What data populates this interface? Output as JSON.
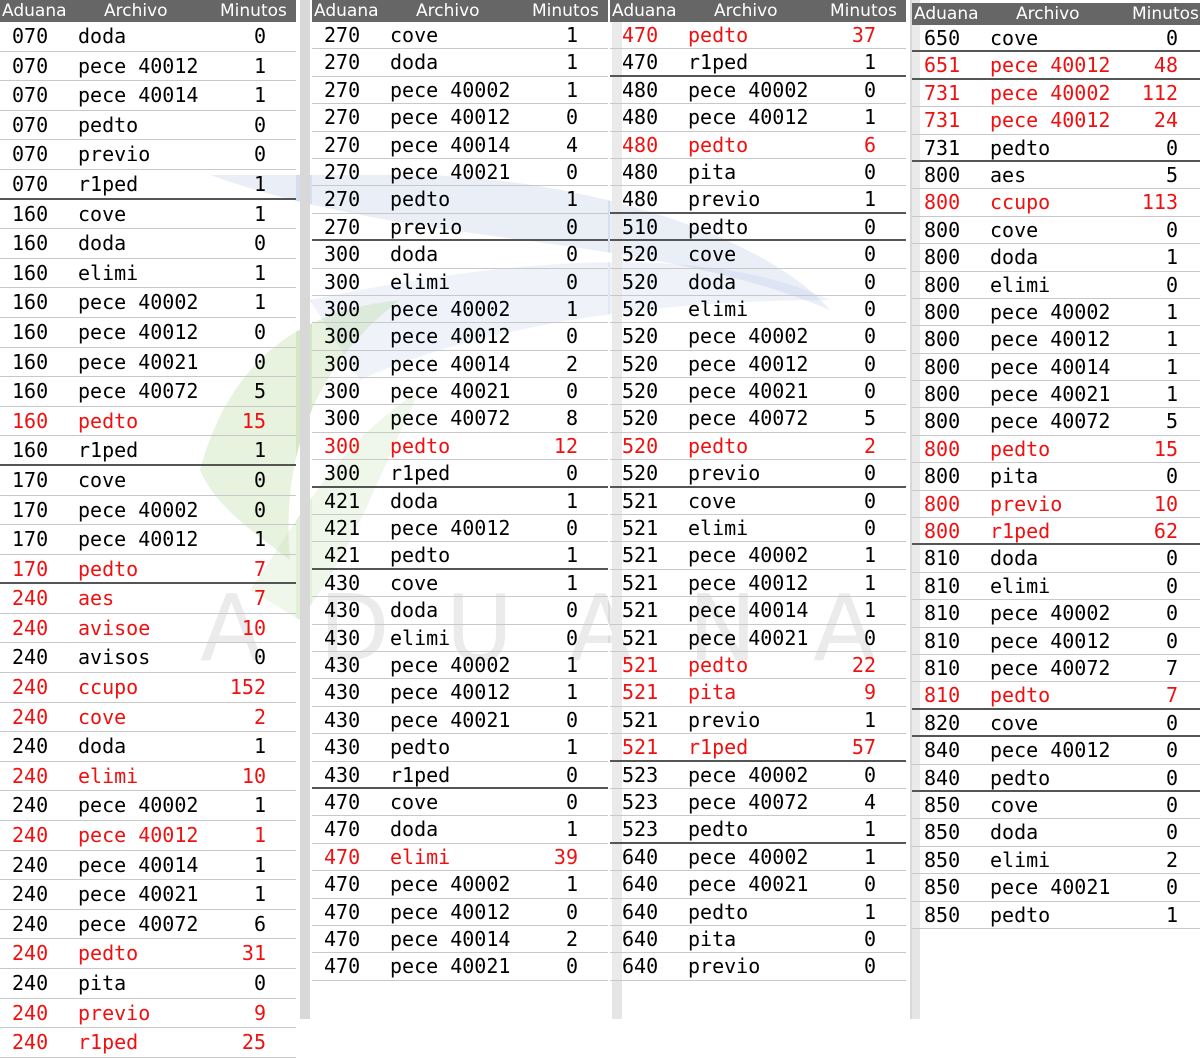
{
  "headers": {
    "aduana": "Aduana",
    "archivo": "Archivo",
    "minutos": "Minutos"
  },
  "watermark": {
    "text": "ADUANA",
    "colors": {
      "blue": "#5b7fc6",
      "green": "#7dbb4f",
      "gray": "#9a9a9a"
    }
  },
  "colors": {
    "header_bg": "#666666",
    "header_text": "#ffffff",
    "highlight_text": "#ee1111",
    "normal_text": "#000000"
  },
  "columns": [
    {
      "rows": [
        {
          "aduana": "070",
          "archivo": "doda",
          "minutos": "0"
        },
        {
          "aduana": "070",
          "archivo": "pece 40012",
          "minutos": "1"
        },
        {
          "aduana": "070",
          "archivo": "pece 40014",
          "minutos": "1"
        },
        {
          "aduana": "070",
          "archivo": "pedto",
          "minutos": "0"
        },
        {
          "aduana": "070",
          "archivo": "previo",
          "minutos": "0"
        },
        {
          "aduana": "070",
          "archivo": "r1ped",
          "minutos": "1"
        },
        {
          "aduana": "160",
          "archivo": "cove",
          "minutos": "1"
        },
        {
          "aduana": "160",
          "archivo": "doda",
          "minutos": "0"
        },
        {
          "aduana": "160",
          "archivo": "elimi",
          "minutos": "1"
        },
        {
          "aduana": "160",
          "archivo": "pece 40002",
          "minutos": "1"
        },
        {
          "aduana": "160",
          "archivo": "pece 40012",
          "minutos": "0"
        },
        {
          "aduana": "160",
          "archivo": "pece 40021",
          "minutos": "0"
        },
        {
          "aduana": "160",
          "archivo": "pece 40072",
          "minutos": "5"
        },
        {
          "aduana": "160",
          "archivo": "pedto",
          "minutos": "15",
          "red": true
        },
        {
          "aduana": "160",
          "archivo": "r1ped",
          "minutos": "1"
        },
        {
          "aduana": "170",
          "archivo": "cove",
          "minutos": "0"
        },
        {
          "aduana": "170",
          "archivo": "pece 40002",
          "minutos": "0"
        },
        {
          "aduana": "170",
          "archivo": "pece 40012",
          "minutos": "1"
        },
        {
          "aduana": "170",
          "archivo": "pedto",
          "minutos": "7",
          "red": true
        },
        {
          "aduana": "240",
          "archivo": "aes",
          "minutos": "7",
          "red": true
        },
        {
          "aduana": "240",
          "archivo": "avisoe",
          "minutos": "10",
          "red": true
        },
        {
          "aduana": "240",
          "archivo": "avisos",
          "minutos": "0"
        },
        {
          "aduana": "240",
          "archivo": "ccupo",
          "minutos": "152",
          "red": true
        },
        {
          "aduana": "240",
          "archivo": "cove",
          "minutos": "2",
          "red": true
        },
        {
          "aduana": "240",
          "archivo": "doda",
          "minutos": "1"
        },
        {
          "aduana": "240",
          "archivo": "elimi",
          "minutos": "10",
          "red": true
        },
        {
          "aduana": "240",
          "archivo": "pece 40002",
          "minutos": "1"
        },
        {
          "aduana": "240",
          "archivo": "pece 40012",
          "minutos": "1",
          "red": true
        },
        {
          "aduana": "240",
          "archivo": "pece 40014",
          "minutos": "1"
        },
        {
          "aduana": "240",
          "archivo": "pece 40021",
          "minutos": "1"
        },
        {
          "aduana": "240",
          "archivo": "pece 40072",
          "minutos": "6"
        },
        {
          "aduana": "240",
          "archivo": "pedto",
          "minutos": "31",
          "red": true
        },
        {
          "aduana": "240",
          "archivo": "pita",
          "minutos": "0"
        },
        {
          "aduana": "240",
          "archivo": "previo",
          "minutos": "9",
          "red": true
        },
        {
          "aduana": "240",
          "archivo": "r1ped",
          "minutos": "25",
          "red": true
        }
      ]
    },
    {
      "rows": [
        {
          "aduana": "270",
          "archivo": "cove",
          "minutos": "1"
        },
        {
          "aduana": "270",
          "archivo": "doda",
          "minutos": "1"
        },
        {
          "aduana": "270",
          "archivo": "pece 40002",
          "minutos": "1"
        },
        {
          "aduana": "270",
          "archivo": "pece 40012",
          "minutos": "0"
        },
        {
          "aduana": "270",
          "archivo": "pece 40014",
          "minutos": "4"
        },
        {
          "aduana": "270",
          "archivo": "pece 40021",
          "minutos": "0"
        },
        {
          "aduana": "270",
          "archivo": "pedto",
          "minutos": "1"
        },
        {
          "aduana": "270",
          "archivo": "previo",
          "minutos": "0"
        },
        {
          "aduana": "300",
          "archivo": "doda",
          "minutos": "0"
        },
        {
          "aduana": "300",
          "archivo": "elimi",
          "minutos": "0"
        },
        {
          "aduana": "300",
          "archivo": "pece 40002",
          "minutos": "1"
        },
        {
          "aduana": "300",
          "archivo": "pece 40012",
          "minutos": "0"
        },
        {
          "aduana": "300",
          "archivo": "pece 40014",
          "minutos": "2"
        },
        {
          "aduana": "300",
          "archivo": "pece 40021",
          "minutos": "0"
        },
        {
          "aduana": "300",
          "archivo": "pece 40072",
          "minutos": "8"
        },
        {
          "aduana": "300",
          "archivo": "pedto",
          "minutos": "12",
          "red": true
        },
        {
          "aduana": "300",
          "archivo": "r1ped",
          "minutos": "0"
        },
        {
          "aduana": "421",
          "archivo": "doda",
          "minutos": "1"
        },
        {
          "aduana": "421",
          "archivo": "pece 40012",
          "minutos": "0"
        },
        {
          "aduana": "421",
          "archivo": "pedto",
          "minutos": "1"
        },
        {
          "aduana": "430",
          "archivo": "cove",
          "minutos": "1"
        },
        {
          "aduana": "430",
          "archivo": "doda",
          "minutos": "0"
        },
        {
          "aduana": "430",
          "archivo": "elimi",
          "minutos": "0"
        },
        {
          "aduana": "430",
          "archivo": "pece 40002",
          "minutos": "1"
        },
        {
          "aduana": "430",
          "archivo": "pece 40012",
          "minutos": "1"
        },
        {
          "aduana": "430",
          "archivo": "pece 40021",
          "minutos": "0"
        },
        {
          "aduana": "430",
          "archivo": "pedto",
          "minutos": "1"
        },
        {
          "aduana": "430",
          "archivo": "r1ped",
          "minutos": "0"
        },
        {
          "aduana": "470",
          "archivo": "cove",
          "minutos": "0"
        },
        {
          "aduana": "470",
          "archivo": "doda",
          "minutos": "1"
        },
        {
          "aduana": "470",
          "archivo": "elimi",
          "minutos": "39",
          "red": true
        },
        {
          "aduana": "470",
          "archivo": "pece 40002",
          "minutos": "1"
        },
        {
          "aduana": "470",
          "archivo": "pece 40012",
          "minutos": "0"
        },
        {
          "aduana": "470",
          "archivo": "pece 40014",
          "minutos": "2"
        },
        {
          "aduana": "470",
          "archivo": "pece 40021",
          "minutos": "0"
        }
      ]
    },
    {
      "rows": [
        {
          "aduana": "470",
          "archivo": "pedto",
          "minutos": "37",
          "red": true
        },
        {
          "aduana": "470",
          "archivo": "r1ped",
          "minutos": "1"
        },
        {
          "aduana": "480",
          "archivo": "pece 40002",
          "minutos": "0"
        },
        {
          "aduana": "480",
          "archivo": "pece 40012",
          "minutos": "1"
        },
        {
          "aduana": "480",
          "archivo": "pedto",
          "minutos": "6",
          "red": true
        },
        {
          "aduana": "480",
          "archivo": "pita",
          "minutos": "0"
        },
        {
          "aduana": "480",
          "archivo": "previo",
          "minutos": "1"
        },
        {
          "aduana": "510",
          "archivo": "pedto",
          "minutos": "0"
        },
        {
          "aduana": "520",
          "archivo": "cove",
          "minutos": "0"
        },
        {
          "aduana": "520",
          "archivo": "doda",
          "minutos": "0"
        },
        {
          "aduana": "520",
          "archivo": "elimi",
          "minutos": "0"
        },
        {
          "aduana": "520",
          "archivo": "pece 40002",
          "minutos": "0"
        },
        {
          "aduana": "520",
          "archivo": "pece 40012",
          "minutos": "0"
        },
        {
          "aduana": "520",
          "archivo": "pece 40021",
          "minutos": "0"
        },
        {
          "aduana": "520",
          "archivo": "pece 40072",
          "minutos": "5"
        },
        {
          "aduana": "520",
          "archivo": "pedto",
          "minutos": "2",
          "red": true
        },
        {
          "aduana": "520",
          "archivo": "previo",
          "minutos": "0"
        },
        {
          "aduana": "521",
          "archivo": "cove",
          "minutos": "0"
        },
        {
          "aduana": "521",
          "archivo": "elimi",
          "minutos": "0"
        },
        {
          "aduana": "521",
          "archivo": "pece 40002",
          "minutos": "1"
        },
        {
          "aduana": "521",
          "archivo": "pece 40012",
          "minutos": "1"
        },
        {
          "aduana": "521",
          "archivo": "pece 40014",
          "minutos": "1"
        },
        {
          "aduana": "521",
          "archivo": "pece 40021",
          "minutos": "0"
        },
        {
          "aduana": "521",
          "archivo": "pedto",
          "minutos": "22",
          "red": true
        },
        {
          "aduana": "521",
          "archivo": "pita",
          "minutos": "9",
          "red": true
        },
        {
          "aduana": "521",
          "archivo": "previo",
          "minutos": "1"
        },
        {
          "aduana": "521",
          "archivo": "r1ped",
          "minutos": "57",
          "red": true
        },
        {
          "aduana": "523",
          "archivo": "pece 40002",
          "minutos": "0"
        },
        {
          "aduana": "523",
          "archivo": "pece 40072",
          "minutos": "4"
        },
        {
          "aduana": "523",
          "archivo": "pedto",
          "minutos": "1"
        },
        {
          "aduana": "640",
          "archivo": "pece 40002",
          "minutos": "1"
        },
        {
          "aduana": "640",
          "archivo": "pece 40021",
          "minutos": "0"
        },
        {
          "aduana": "640",
          "archivo": "pedto",
          "minutos": "1"
        },
        {
          "aduana": "640",
          "archivo": "pita",
          "minutos": "0"
        },
        {
          "aduana": "640",
          "archivo": "previo",
          "minutos": "0"
        }
      ]
    },
    {
      "rows": [
        {
          "aduana": "650",
          "archivo": "cove",
          "minutos": "0"
        },
        {
          "aduana": "651",
          "archivo": "pece 40012",
          "minutos": "48",
          "red": true
        },
        {
          "aduana": "731",
          "archivo": "pece 40002",
          "minutos": "112",
          "red": true
        },
        {
          "aduana": "731",
          "archivo": "pece 40012",
          "minutos": "24",
          "red": true
        },
        {
          "aduana": "731",
          "archivo": "pedto",
          "minutos": "0"
        },
        {
          "aduana": "800",
          "archivo": "aes",
          "minutos": "5"
        },
        {
          "aduana": "800",
          "archivo": "ccupo",
          "minutos": "113",
          "red": true
        },
        {
          "aduana": "800",
          "archivo": "cove",
          "minutos": "0"
        },
        {
          "aduana": "800",
          "archivo": "doda",
          "minutos": "1"
        },
        {
          "aduana": "800",
          "archivo": "elimi",
          "minutos": "0"
        },
        {
          "aduana": "800",
          "archivo": "pece 40002",
          "minutos": "1"
        },
        {
          "aduana": "800",
          "archivo": "pece 40012",
          "minutos": "1"
        },
        {
          "aduana": "800",
          "archivo": "pece 40014",
          "minutos": "1"
        },
        {
          "aduana": "800",
          "archivo": "pece 40021",
          "minutos": "1"
        },
        {
          "aduana": "800",
          "archivo": "pece 40072",
          "minutos": "5"
        },
        {
          "aduana": "800",
          "archivo": "pedto",
          "minutos": "15",
          "red": true
        },
        {
          "aduana": "800",
          "archivo": "pita",
          "minutos": "0"
        },
        {
          "aduana": "800",
          "archivo": "previo",
          "minutos": "10",
          "red": true
        },
        {
          "aduana": "800",
          "archivo": "r1ped",
          "minutos": "62",
          "red": true
        },
        {
          "aduana": "810",
          "archivo": "doda",
          "minutos": "0"
        },
        {
          "aduana": "810",
          "archivo": "elimi",
          "minutos": "0"
        },
        {
          "aduana": "810",
          "archivo": "pece 40002",
          "minutos": "0"
        },
        {
          "aduana": "810",
          "archivo": "pece 40012",
          "minutos": "0"
        },
        {
          "aduana": "810",
          "archivo": "pece 40072",
          "minutos": "7"
        },
        {
          "aduana": "810",
          "archivo": "pedto",
          "minutos": "7",
          "red": true
        },
        {
          "aduana": "820",
          "archivo": "cove",
          "minutos": "0"
        },
        {
          "aduana": "840",
          "archivo": "pece 40012",
          "minutos": "0"
        },
        {
          "aduana": "840",
          "archivo": "pedto",
          "minutos": "0"
        },
        {
          "aduana": "850",
          "archivo": "cove",
          "minutos": "0"
        },
        {
          "aduana": "850",
          "archivo": "doda",
          "minutos": "0"
        },
        {
          "aduana": "850",
          "archivo": "elimi",
          "minutos": "2"
        },
        {
          "aduana": "850",
          "archivo": "pece 40021",
          "minutos": "0"
        },
        {
          "aduana": "850",
          "archivo": "pedto",
          "minutos": "1"
        }
      ]
    }
  ]
}
